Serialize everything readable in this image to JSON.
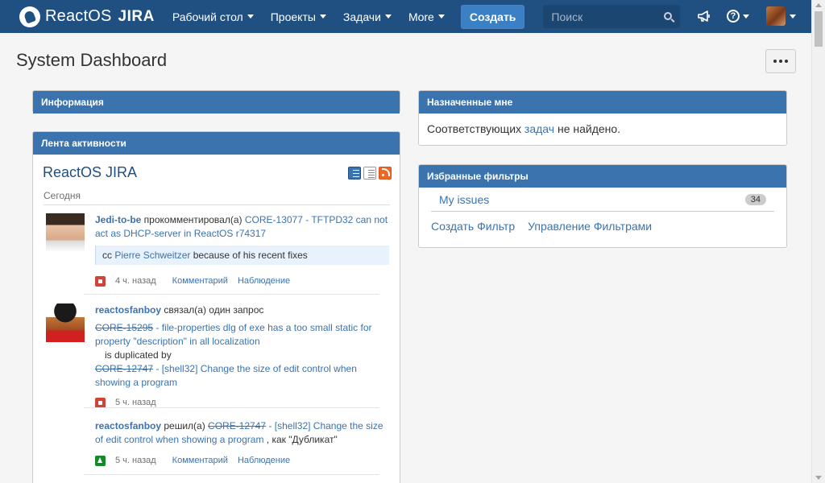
{
  "nav": {
    "brand": "ReactOS",
    "brand_jira": "JIRA",
    "items": [
      "Рабочий стол",
      "Проекты",
      "Задачи",
      "More"
    ],
    "create": "Создать",
    "search_placeholder": "Поиск",
    "help_symbol": "?"
  },
  "page": {
    "title": "System Dashboard"
  },
  "gadgets": {
    "info": {
      "title": "Информация"
    },
    "assigned": {
      "title": "Назначенные мне",
      "text_before": "Соответствующих ",
      "link": "задач",
      "text_after": " не найдено."
    },
    "filters": {
      "title": "Избранные фильтры",
      "items": [
        {
          "label": "My issues",
          "count": "34"
        }
      ],
      "create_filter": "Создать Фильтр",
      "manage_filters": "Управление Фильтрами"
    },
    "feed": {
      "title": "Лента активности",
      "feed_name": "ReactOS JIRA",
      "day": "Сегодня",
      "activities": [
        {
          "user": "Jedi-to-be",
          "action": " прокомментировал(а) ",
          "issue": "CORE-13077 - TFTPD32 can not act as DHCP-server in ReactOS r74317",
          "comment_prefix": "cc ",
          "comment_link": "Pierre Schweitzer",
          "comment_suffix": " because of his recent fixes",
          "time": "4 ч. назад",
          "comment_action": "Комментарий",
          "watch_action": "Наблюдение"
        },
        {
          "user": "reactosfanboy",
          "action": " связал(а) один запрос",
          "issue1_key": "CORE-15295",
          "issue1_summary": " - file-properties dlg of exe has a too small static for property \"description\" in all localization",
          "relation": "is duplicated by",
          "issue2_key": "CORE-12747",
          "issue2_summary": " - [shell32] Change the size of edit control when showing a program",
          "time": "5 ч. назад"
        },
        {
          "user": "reactosfanboy",
          "action": " решил(а) ",
          "issue_key": "CORE-12747",
          "issue_summary": " - [shell32] Change the size of edit control when showing a program",
          "resolution": " , как \"Дубликат\"",
          "time": "5 ч. назад",
          "comment_action": "Комментарий",
          "watch_action": "Наблюдение"
        }
      ]
    }
  },
  "colors": {
    "header": "#205081",
    "gadget_header": "#3b73af",
    "link": "#3b73af",
    "priority_red": "#d04437",
    "priority_green": "#14892c"
  }
}
